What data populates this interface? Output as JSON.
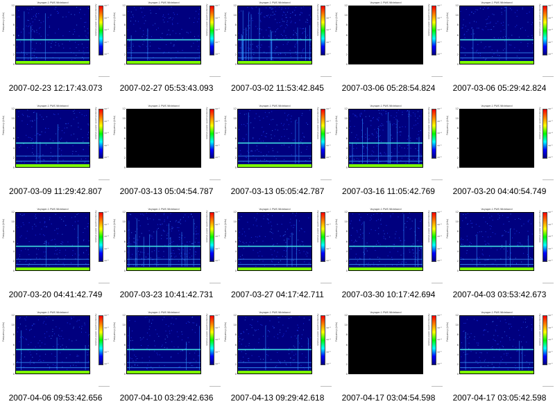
{
  "thumbnails": [
    {
      "caption": "2007-02-23 12:17:43.073",
      "blank": false,
      "density": 0.55,
      "spikes": 3
    },
    {
      "caption": "2007-02-27 05:53:43.093",
      "blank": false,
      "density": 0.5,
      "spikes": 2
    },
    {
      "caption": "2007-03-02 11:53:42.845",
      "blank": false,
      "density": 0.85,
      "spikes": 14
    },
    {
      "caption": "2007-03-06 05:28:54.824",
      "blank": true,
      "density": 0,
      "spikes": 0
    },
    {
      "caption": "2007-03-06 05:29:42.824",
      "blank": false,
      "density": 0.55,
      "spikes": 2
    },
    {
      "caption": "2007-03-09 11:29:42.807",
      "blank": false,
      "density": 0.5,
      "spikes": 3
    },
    {
      "caption": "2007-03-13 05:04:54.787",
      "blank": true,
      "density": 0,
      "spikes": 0
    },
    {
      "caption": "2007-03-13 05:05:42.787",
      "blank": false,
      "density": 0.5,
      "spikes": 3
    },
    {
      "caption": "2007-03-16 11:05:42.769",
      "blank": false,
      "density": 0.8,
      "spikes": 12
    },
    {
      "caption": "2007-03-20 04:40:54.749",
      "blank": true,
      "density": 0,
      "spikes": 0
    },
    {
      "caption": "2007-03-20 04:41:42.749",
      "blank": false,
      "density": 0.55,
      "spikes": 2
    },
    {
      "caption": "2007-03-23 10:41:42.731",
      "blank": false,
      "density": 0.8,
      "spikes": 12
    },
    {
      "caption": "2007-03-27 04:17:42.711",
      "blank": false,
      "density": 0.55,
      "spikes": 3
    },
    {
      "caption": "2007-03-30 10:17:42.694",
      "blank": false,
      "density": 0.6,
      "spikes": 5
    },
    {
      "caption": "2007-04-03 03:53:42.673",
      "blank": false,
      "density": 0.55,
      "spikes": 4
    },
    {
      "caption": "2007-04-06 09:53:42.656",
      "blank": false,
      "density": 0.55,
      "spikes": 3
    },
    {
      "caption": "2007-04-10 03:29:42.636",
      "blank": false,
      "density": 0.5,
      "spikes": 3
    },
    {
      "caption": "2007-04-13 09:29:42.618",
      "blank": false,
      "density": 0.55,
      "spikes": 3
    },
    {
      "caption": "2007-04-17 03:04:54.598",
      "blank": true,
      "density": 0,
      "spikes": 0
    },
    {
      "caption": "2007-04-17 03:05:42.598",
      "blank": false,
      "density": 0.55,
      "spikes": 3
    }
  ],
  "axes": {
    "ylabel": "Frequency (kHz)",
    "yticks": [
      "12",
      "10",
      "8",
      "6",
      "4",
      "2",
      "0"
    ],
    "colorbar_label": "relative power spectral density",
    "colorbar_ticks": [
      "10⁻²",
      "10⁻³",
      "10⁻⁴",
      "10⁻⁵",
      "10⁻⁶"
    ],
    "plot_title": "Voyager-1 PWS Wideband"
  },
  "colors": {
    "background_low": "#00007f",
    "noise_mid": "#1e3cff",
    "line": "#40e0e0",
    "floor": "#7fff00"
  },
  "chart_data": {
    "type": "heatmap",
    "ylim": [
      0,
      12
    ],
    "ylabel": "Frequency (kHz)",
    "colorbar_label": "relative power spectral density",
    "horizontal_lines_khz": [
      5,
      2.3,
      1.2
    ]
  }
}
